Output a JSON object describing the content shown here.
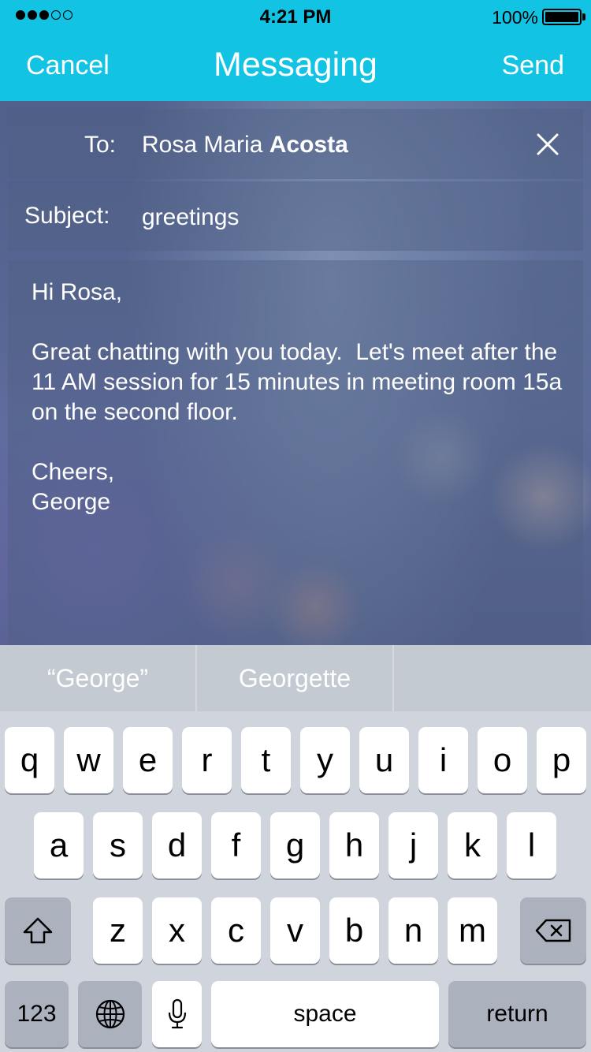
{
  "status_bar": {
    "time": "4:21 PM",
    "battery": "100%",
    "signal_bars_filled": 3,
    "signal_bars_total": 5
  },
  "nav": {
    "cancel_label": "Cancel",
    "title": "Messaging",
    "send_label": "Send"
  },
  "form": {
    "to_label": "To:",
    "to_first_names": "Rosa Maria ",
    "to_last_name": "Acosta",
    "subject_label": "Subject:",
    "subject_value": "greetings",
    "body": "Hi Rosa,\n\nGreat chatting with you today.  Let's meet after the 11 AM session for 15 minutes in meeting room 15a on the second floor.\n\nCheers,\nGeorge"
  },
  "suggestions": [
    "“George”",
    "Georgette",
    ""
  ],
  "keyboard": {
    "row1": [
      "q",
      "w",
      "e",
      "r",
      "t",
      "y",
      "u",
      "i",
      "o",
      "p"
    ],
    "row2": [
      "a",
      "s",
      "d",
      "f",
      "g",
      "h",
      "j",
      "k",
      "l"
    ],
    "row3": [
      "z",
      "x",
      "c",
      "v",
      "b",
      "n",
      "m"
    ],
    "numbers_label": "123",
    "space_label": "space",
    "return_label": "return"
  },
  "colors": {
    "header": "#12c3e3",
    "keyboard": "#d0d4dc"
  }
}
